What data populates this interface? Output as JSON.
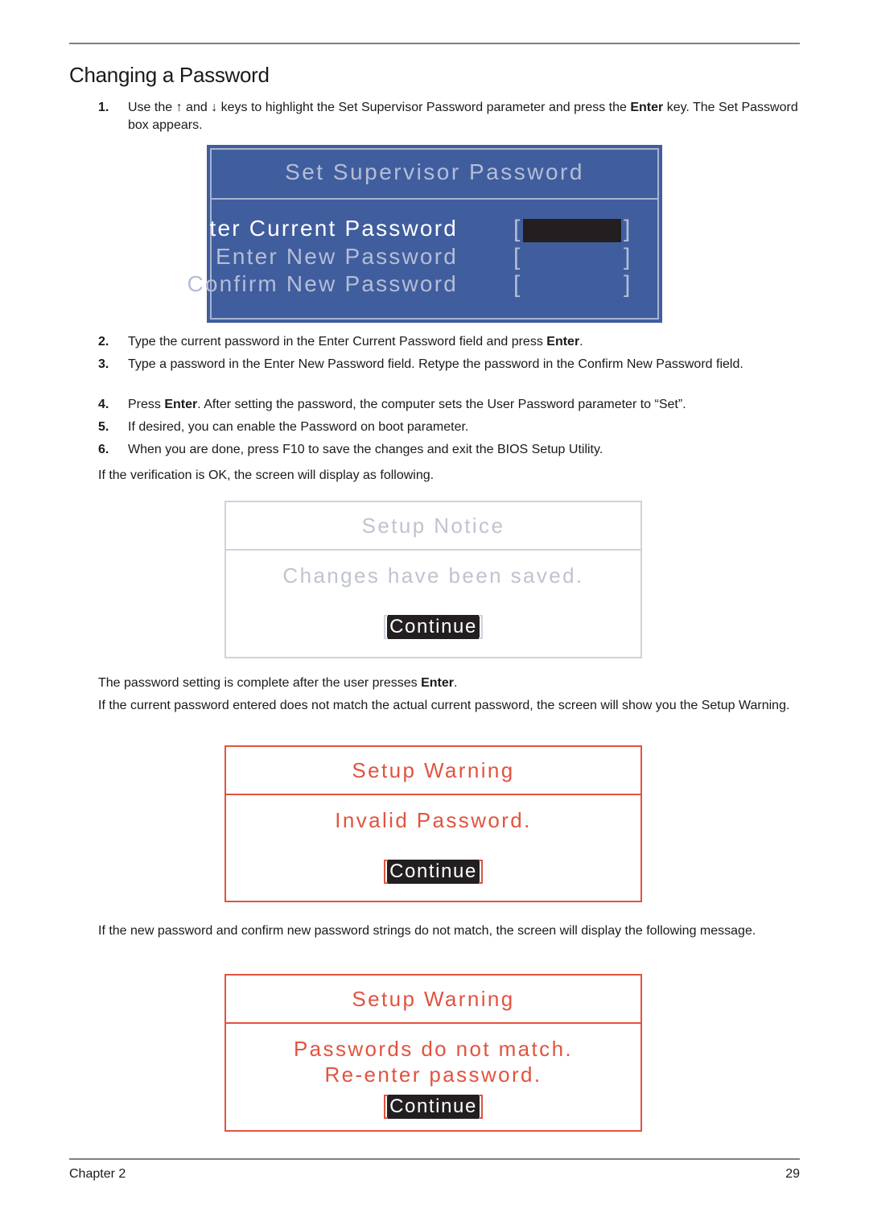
{
  "page": {
    "title": "Changing a Password",
    "footer": {
      "chapter": "Chapter 2",
      "page_number": "29"
    }
  },
  "steps": [
    {
      "num": "1.",
      "parts": [
        "Use the ",
        "↑",
        " and ",
        "↓",
        " keys to highlight the Set Supervisor Password parameter and press the ",
        "Enter",
        " key. The Set Password box appears."
      ]
    },
    {
      "num": "2.",
      "before": "Type the current password in the Enter Current Password field and press ",
      "bold": "Enter",
      "after": "."
    },
    {
      "num": "3.",
      "text": "Type a password in the Enter New Password field. Retype the password in the Confirm New Password field."
    },
    {
      "num": "4.",
      "before": "Press ",
      "bold": "Enter",
      "after": ". After setting the password, the computer sets the User Password parameter to “Set”."
    },
    {
      "num": "5.",
      "text": "If desired, you can enable the Password on boot parameter."
    },
    {
      "num": "6.",
      "text": "When you are done, press F10 to save the changes and exit the BIOS Setup Utility."
    }
  ],
  "paragraphs": {
    "verification": "If the verification is OK, the screen will display as following.",
    "complete_before": "The password setting is complete after the user presses ",
    "complete_bold": "Enter",
    "complete_after": ".",
    "mismatch_current": "If the current password entered does not match the actual current password, the screen will show you the Setup Warning.",
    "mismatch_new": "If the new password and confirm new password strings do not match, the screen will display the following message."
  },
  "bios_dialog": {
    "title": "Set Supervisor Password",
    "fields": [
      {
        "label": "Enter Current Password",
        "value": "",
        "active": true
      },
      {
        "label": "Enter New Password",
        "value": "",
        "active": false
      },
      {
        "label": "Confirm New Password",
        "value": "",
        "active": false
      }
    ],
    "colors": {
      "background": "#405e9e",
      "border": "#a9b3cf",
      "text": "#b5bdd6",
      "active_text": "#ffffff",
      "field_highlight": "#231f20"
    }
  },
  "setup_notice": {
    "title": "Setup Notice",
    "message": "Changes have been saved.",
    "button": "Continue",
    "color": "#c0c3cf"
  },
  "setup_warning_invalid": {
    "title": "Setup Warning",
    "message": "Invalid Password.",
    "button": "Continue",
    "color": "#e2533f"
  },
  "setup_warning_mismatch": {
    "title": "Setup Warning",
    "message_line1": "Passwords do not match.",
    "message_line2": "Re-enter password.",
    "button": "Continue",
    "color": "#e2533f"
  }
}
